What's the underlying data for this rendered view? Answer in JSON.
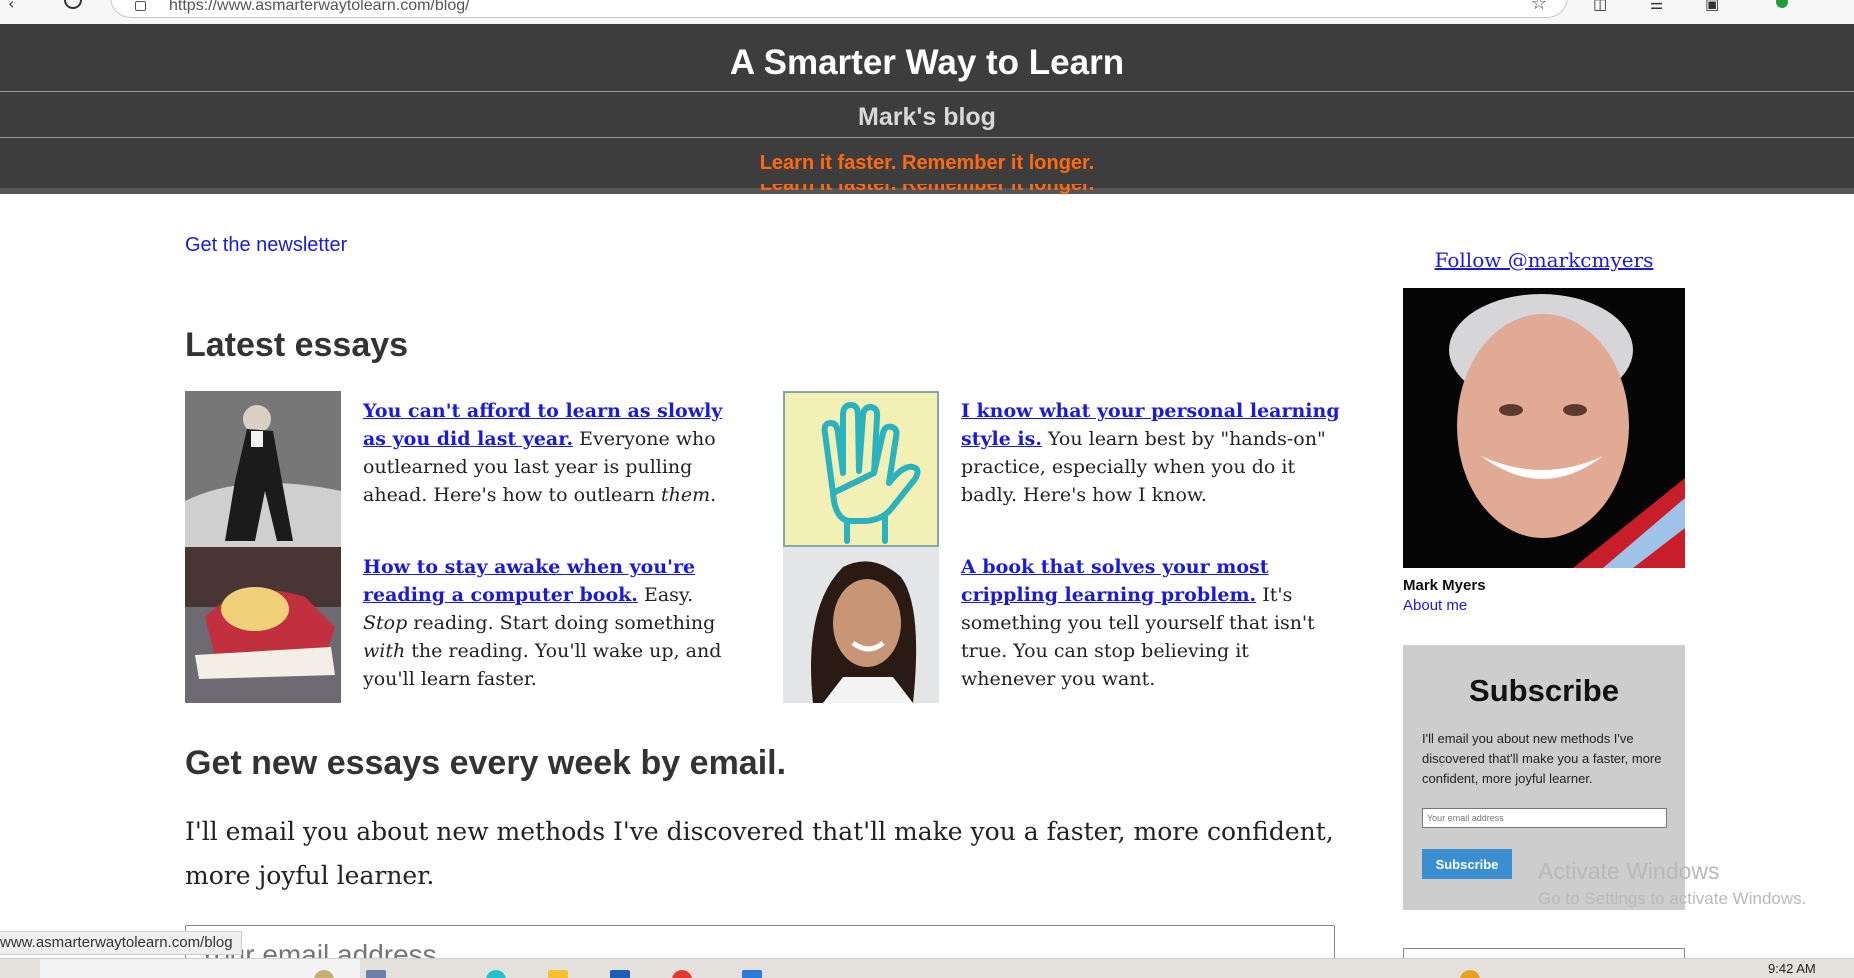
{
  "browser": {
    "url": "https://www.asmarterwaytolearn.com/blog/",
    "back_icon": "back-arrow-icon",
    "refresh_icon": "refresh-icon",
    "favorite_icon": "star-icon"
  },
  "header": {
    "site_title": "A Smarter Way to Learn",
    "subtitle": "Mark's blog",
    "tagline": "Learn it faster. Remember it longer.",
    "tagline_color": "#ff6a10",
    "bg_color": "#3d3d3d"
  },
  "main": {
    "newsletter_link": "Get the newsletter",
    "latest_heading": "Latest essays",
    "essays": [
      {
        "title": "You can't afford to learn as slowly as you did last year.",
        "desc_before": " Everyone who outlearned you last year is pulling ahead. Here's how to outlearn ",
        "desc_em": "them",
        "desc_after": ".",
        "image": "man-in-suit-photo"
      },
      {
        "title": "I know what your personal learning style is.",
        "desc_before": " You learn best by \"hands-on\" practice, especially when you do it badly. Here's how I know.",
        "desc_em": "",
        "desc_after": "",
        "image": "raised-hand-icon"
      },
      {
        "title": "How to stay awake when you're reading a computer book.",
        "desc_before": " Easy. ",
        "desc_em": "Stop",
        "desc_after": " reading. Start doing something ",
        "desc_em2": "with",
        "desc_after2": " the reading. You'll wake up, and you'll learn faster.",
        "image": "asleep-on-book-photo"
      },
      {
        "title": "A book that solves your most crippling learning problem.",
        "desc_before": " It's something you tell yourself that isn't true. You can stop believing it whenever you want.",
        "desc_em": "",
        "desc_after": "",
        "image": "smiling-woman-photo"
      }
    ],
    "email_heading": "Get new essays every week by email.",
    "email_paragraph": "I'll email you about new methods I've discovered that'll make you a faster, more confident, more joyful learner.",
    "email_placeholder": "Your email address"
  },
  "sidebar": {
    "follow_link": "Follow @markcmyers",
    "author_name": "Mark Myers",
    "about_link": "About me",
    "subscribe": {
      "title": "Subscribe",
      "text": "I'll email you about new methods I've discovered that'll make you a faster, more confident, more joyful learner.",
      "placeholder": "Your email address",
      "button": "Subscribe"
    }
  },
  "overlay": {
    "watermark_title": "Activate Windows",
    "watermark_sub": "Go to Settings to activate Windows.",
    "status_url": "www.asmarterwaytolearn.com/blog"
  },
  "taskbar": {
    "clock": "9:42 AM"
  }
}
